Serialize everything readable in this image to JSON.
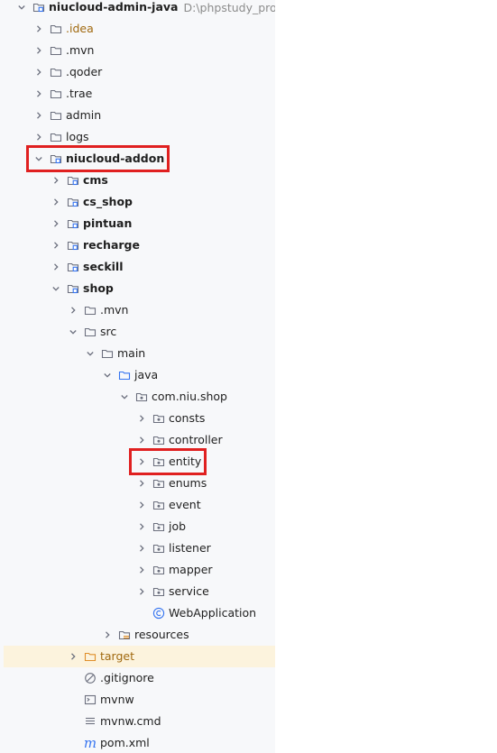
{
  "project_root": {
    "name": "niucloud-admin-java",
    "path": "D:\\phpstudy_pro\\W"
  },
  "tree": [
    {
      "label": "niucloud-admin-java",
      "depth": 0,
      "expanded": true,
      "icon": "module-folder-icon",
      "bold": true,
      "path": "D:\\phpstudy_pro\\W"
    },
    {
      "label": ".idea",
      "depth": 1,
      "expanded": false,
      "icon": "folder-icon",
      "style": "muted"
    },
    {
      "label": ".mvn",
      "depth": 1,
      "expanded": false,
      "icon": "folder-icon"
    },
    {
      "label": ".qoder",
      "depth": 1,
      "expanded": false,
      "icon": "folder-icon"
    },
    {
      "label": ".trae",
      "depth": 1,
      "expanded": false,
      "icon": "folder-icon"
    },
    {
      "label": "admin",
      "depth": 1,
      "expanded": false,
      "icon": "folder-icon"
    },
    {
      "label": "logs",
      "depth": 1,
      "expanded": false,
      "icon": "folder-icon"
    },
    {
      "label": "niucloud-addon",
      "depth": 1,
      "expanded": true,
      "icon": "module-folder-icon",
      "bold": true,
      "highlighted": true
    },
    {
      "label": "cms",
      "depth": 2,
      "expanded": false,
      "icon": "module-folder-icon",
      "bold": true
    },
    {
      "label": "cs_shop",
      "depth": 2,
      "expanded": false,
      "icon": "module-folder-icon",
      "bold": true
    },
    {
      "label": "pintuan",
      "depth": 2,
      "expanded": false,
      "icon": "module-folder-icon",
      "bold": true
    },
    {
      "label": "recharge",
      "depth": 2,
      "expanded": false,
      "icon": "module-folder-icon",
      "bold": true
    },
    {
      "label": "seckill",
      "depth": 2,
      "expanded": false,
      "icon": "module-folder-icon",
      "bold": true
    },
    {
      "label": "shop",
      "depth": 2,
      "expanded": true,
      "icon": "module-folder-icon",
      "bold": true
    },
    {
      "label": ".mvn",
      "depth": 3,
      "expanded": false,
      "icon": "folder-icon"
    },
    {
      "label": "src",
      "depth": 3,
      "expanded": true,
      "icon": "folder-icon"
    },
    {
      "label": "main",
      "depth": 4,
      "expanded": true,
      "icon": "folder-icon"
    },
    {
      "label": "java",
      "depth": 5,
      "expanded": true,
      "icon": "source-folder-icon"
    },
    {
      "label": "com.niu.shop",
      "depth": 6,
      "expanded": true,
      "icon": "package-icon"
    },
    {
      "label": "consts",
      "depth": 7,
      "expanded": false,
      "icon": "package-icon"
    },
    {
      "label": "controller",
      "depth": 7,
      "expanded": false,
      "icon": "package-icon"
    },
    {
      "label": "entity",
      "depth": 7,
      "expanded": false,
      "icon": "package-icon",
      "highlighted": true
    },
    {
      "label": "enums",
      "depth": 7,
      "expanded": false,
      "icon": "package-icon"
    },
    {
      "label": "event",
      "depth": 7,
      "expanded": false,
      "icon": "package-icon"
    },
    {
      "label": "job",
      "depth": 7,
      "expanded": false,
      "icon": "package-icon"
    },
    {
      "label": "listener",
      "depth": 7,
      "expanded": false,
      "icon": "package-icon"
    },
    {
      "label": "mapper",
      "depth": 7,
      "expanded": false,
      "icon": "package-icon"
    },
    {
      "label": "service",
      "depth": 7,
      "expanded": false,
      "icon": "package-icon"
    },
    {
      "label": "WebApplication",
      "depth": 7,
      "expanded": null,
      "icon": "class-icon"
    },
    {
      "label": "resources",
      "depth": 5,
      "expanded": false,
      "icon": "resources-folder-icon"
    },
    {
      "label": "target",
      "depth": 3,
      "expanded": false,
      "icon": "excluded-folder-icon",
      "style": "muted",
      "excluded": true
    },
    {
      "label": ".gitignore",
      "depth": 3,
      "expanded": null,
      "icon": "gitignore-icon"
    },
    {
      "label": "mvnw",
      "depth": 3,
      "expanded": null,
      "icon": "shell-file-icon"
    },
    {
      "label": "mvnw.cmd",
      "depth": 3,
      "expanded": null,
      "icon": "text-file-icon"
    },
    {
      "label": "pom.xml",
      "depth": 3,
      "expanded": null,
      "icon": "maven-icon"
    }
  ],
  "colors": {
    "panel_background": "#f7f8fa",
    "highlight_border": "#e02020",
    "excluded_row": "#fcf3dd",
    "excluded_text": "#a0690f",
    "class_icon": "#3574f0",
    "maven_icon": "#3574f0",
    "resources_icon": "#e08f2a"
  }
}
